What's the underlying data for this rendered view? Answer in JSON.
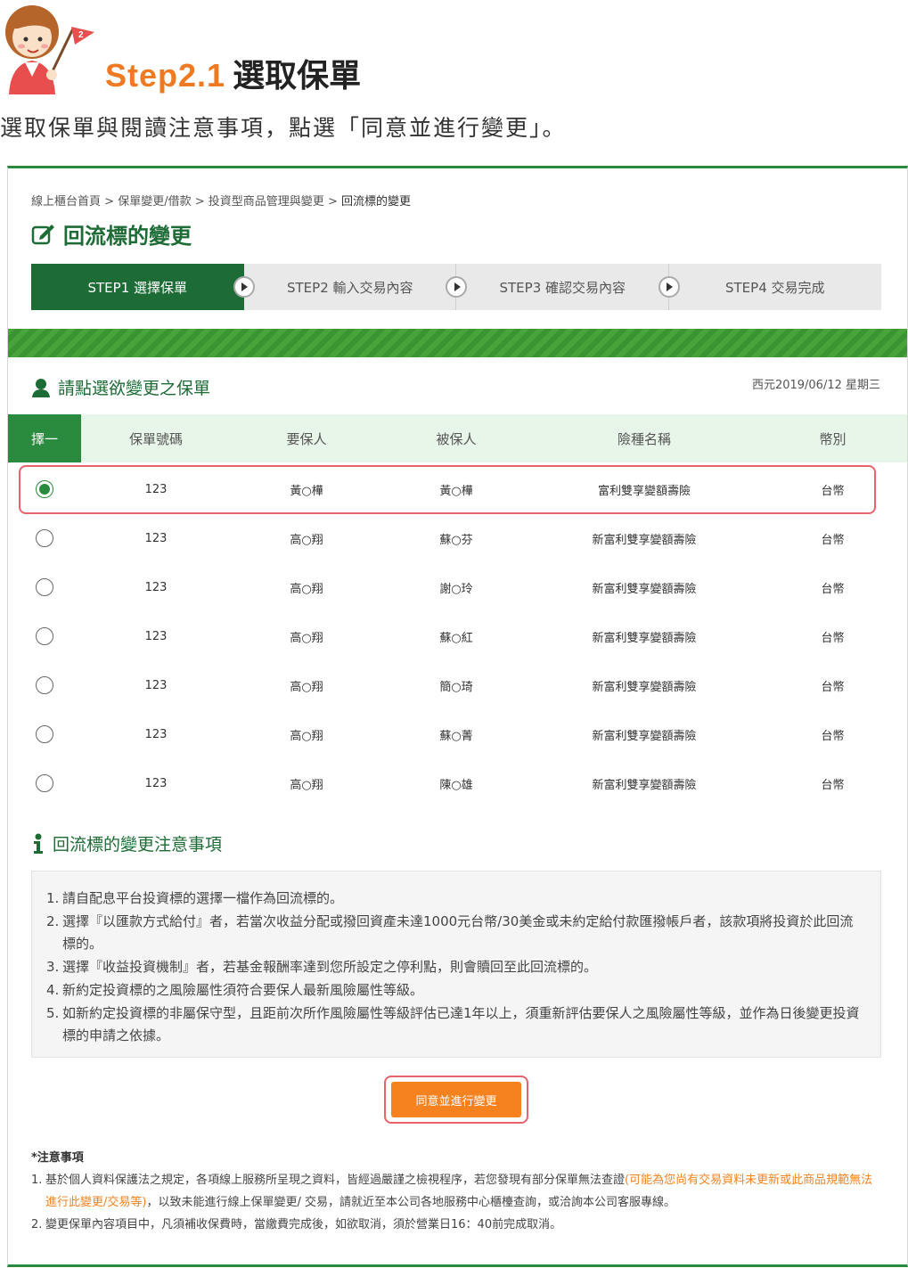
{
  "header": {
    "step_number": "Step2.1",
    "step_title": "選取保單",
    "intro": "選取保單與閱讀注意事項，點選「同意並進行變更」。",
    "mascot_flag_number": "2"
  },
  "breadcrumb": {
    "items": [
      "線上櫃台首頁",
      "保單變更/借款",
      "投資型商品管理與變更"
    ],
    "separator": ">",
    "current": "回流標的變更"
  },
  "page_title": "回流標的變更",
  "steps": [
    {
      "label": "STEP1 選擇保單",
      "active": true
    },
    {
      "label": "STEP2 輸入交易內容",
      "active": false
    },
    {
      "label": "STEP3 確認交易內容",
      "active": false
    },
    {
      "label": "STEP4 交易完成",
      "active": false
    }
  ],
  "select_section": {
    "title": "請點選欲變更之保單",
    "date": "西元2019/06/12 星期三"
  },
  "table": {
    "headers": {
      "select": "擇一",
      "policy_no": "保單號碼",
      "owner": "要保人",
      "insured": "被保人",
      "product": "險種名稱",
      "currency": "幣別"
    },
    "rows": [
      {
        "selected": true,
        "policy_no": "123",
        "owner": "黃○樺",
        "insured": "黃○樺",
        "product": "富利雙享變額壽險",
        "currency": "台幣"
      },
      {
        "selected": false,
        "policy_no": "123",
        "owner": "高○翔",
        "insured": "蘇○芬",
        "product": "新富利雙享變額壽險",
        "currency": "台幣"
      },
      {
        "selected": false,
        "policy_no": "123",
        "owner": "高○翔",
        "insured": "謝○玲",
        "product": "新富利雙享變額壽險",
        "currency": "台幣"
      },
      {
        "selected": false,
        "policy_no": "123",
        "owner": "高○翔",
        "insured": "蘇○紅",
        "product": "新富利雙享變額壽險",
        "currency": "台幣"
      },
      {
        "selected": false,
        "policy_no": "123",
        "owner": "高○翔",
        "insured": "簡○琦",
        "product": "新富利雙享變額壽險",
        "currency": "台幣"
      },
      {
        "selected": false,
        "policy_no": "123",
        "owner": "高○翔",
        "insured": "蘇○菁",
        "product": "新富利雙享變額壽險",
        "currency": "台幣"
      },
      {
        "selected": false,
        "policy_no": "123",
        "owner": "高○翔",
        "insured": "陳○雄",
        "product": "新富利雙享變額壽險",
        "currency": "台幣"
      }
    ]
  },
  "notice_section": {
    "title": "回流標的變更注意事項",
    "items": [
      "請自配息平台投資標的選擇一檔作為回流標的。",
      "選擇『以匯款方式給付』者，若當次收益分配或撥回資產未達1000元台幣/30美金或未約定給付款匯撥帳戶者，該款項將投資於此回流標的。",
      "選擇『收益投資機制』者，若基金報酬率達到您所設定之停利點，則會贖回至此回流標的。",
      "新約定投資標的之風險屬性須符合要保人最新風險屬性等級。",
      "如新約定投資標的非屬保守型，且距前次所作風險屬性等級評估已達1年以上，須重新評估要保人之風險屬性等級，並作為日後變更投資標的申請之依據。"
    ]
  },
  "agree_button": "同意並進行變更",
  "footnote": {
    "title": "*注意事項",
    "item1_pre": "基於個人資料保護法之規定，各項線上服務所呈現之資料，皆經過嚴謹之檢視程序，若您發現有部分保單無法查證",
    "item1_highlight": "(可能為您尚有交易資料未更新或此商品規範無法進行此變更/交易等)",
    "item1_post": "，以致未能進行線上保單變更/ 交易，請就近至本公司各地服務中心櫃檯查詢，或洽詢本公司客服專線。",
    "item2": "變更保單內容項目中，凡須補收保費時，當繳費完成後，如欲取消，須於營業日16：40前完成取消。"
  },
  "colors": {
    "brand_green": "#1d6b35",
    "accent_orange": "#f5821f",
    "highlight_red": "#e8646a"
  }
}
